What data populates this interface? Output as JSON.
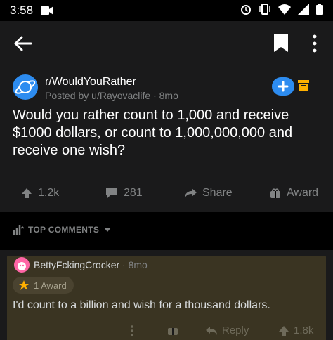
{
  "status_bar": {
    "time": "3:58"
  },
  "post": {
    "subreddit": "r/WouldYouRather",
    "posted_by": "Posted by u/Rayovaclife · 8mo",
    "title": "Would you rather count to 1,000 and receive $1000 dollars, or count to 1,000,000,000 and receive one wish?",
    "upvotes": "1.2k",
    "comments": "281",
    "share_label": "Share",
    "award_label": "Award"
  },
  "comments_sort": {
    "label": "TOP COMMENTS"
  },
  "comment": {
    "author": "BettyFckingCrocker",
    "time": " · 8mo",
    "awards": "1 Award",
    "body": "I'd count to a billion and wish for a thousand dollars.",
    "reply_label": "Reply",
    "votes": "1.8k"
  },
  "colors": {
    "accent": "#2d8cf0",
    "award": "#ffb000",
    "highlight": "#3a3422"
  }
}
